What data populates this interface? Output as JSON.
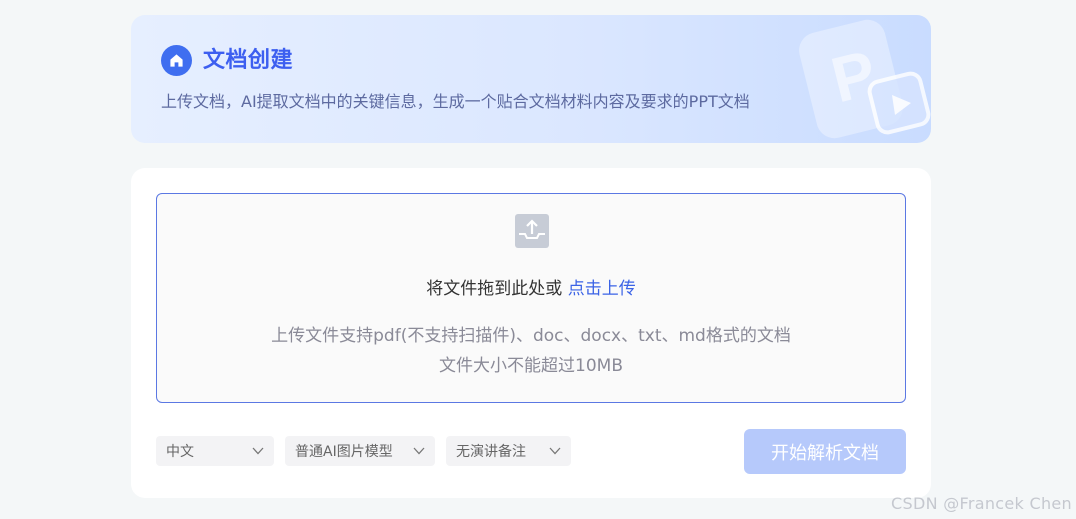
{
  "header": {
    "title": "文档创建",
    "subtitle": "上传文档，AI提取文档中的关键信息，生成一个贴合文档材料内容及要求的PPT文档",
    "icon": "home-icon",
    "decoration_icon": "ppt-play-icon"
  },
  "upload": {
    "icon": "upload-icon",
    "prompt": "将文件拖到此处或 ",
    "link": "点击上传",
    "hint_formats": "上传文件支持pdf(不支持扫描件)、doc、docx、txt、md格式的文档",
    "hint_size": "文件大小不能超过10MB"
  },
  "options": {
    "language": "中文",
    "image_model": "普通AI图片模型",
    "speaker_notes": "无演讲备注"
  },
  "actions": {
    "start": "开始解析文档"
  },
  "watermark": "CSDN @Francek Chen",
  "colors": {
    "accent": "#3f6ef0",
    "link": "#3b63e6",
    "button_disabled": "#b6c9fb"
  }
}
